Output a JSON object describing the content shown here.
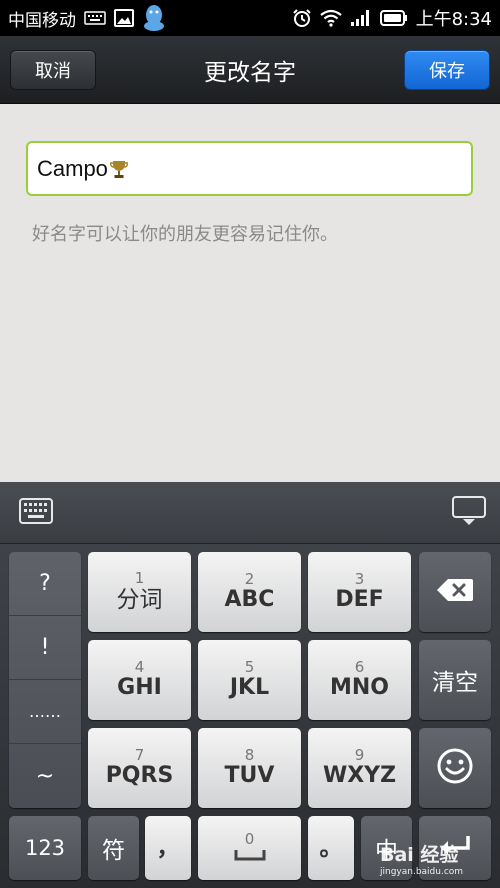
{
  "status_bar": {
    "carrier": "中国移动",
    "time": "上午8:34"
  },
  "title_bar": {
    "cancel_label": "取消",
    "title": "更改名字",
    "save_label": "保存"
  },
  "name_input": {
    "value": "Campo"
  },
  "hint": "好名字可以让你的朋友更容易记住你。",
  "keyboard": {
    "symbols": [
      "?",
      "!",
      "……",
      "~"
    ],
    "keys_row1": [
      {
        "num": "1",
        "label": "分词"
      },
      {
        "num": "2",
        "label": "ABC"
      },
      {
        "num": "3",
        "label": "DEF"
      }
    ],
    "keys_row2": [
      {
        "num": "4",
        "label": "GHI"
      },
      {
        "num": "5",
        "label": "JKL"
      },
      {
        "num": "6",
        "label": "MNO"
      }
    ],
    "keys_row3": [
      {
        "num": "7",
        "label": "PQRS"
      },
      {
        "num": "8",
        "label": "TUV"
      },
      {
        "num": "9",
        "label": "WXYZ"
      }
    ],
    "clear_label": "清空",
    "bottom": {
      "num_label": "123",
      "fu_label": "符",
      "comma_label": "，",
      "space_num": "0",
      "period_label": "。",
      "zh_label": "中"
    }
  },
  "watermark": {
    "brand": "Bai 经验",
    "url": "jingyan.baidu.com"
  },
  "colors": {
    "accent": "#1b74e0",
    "input_border": "#9acd3c"
  }
}
